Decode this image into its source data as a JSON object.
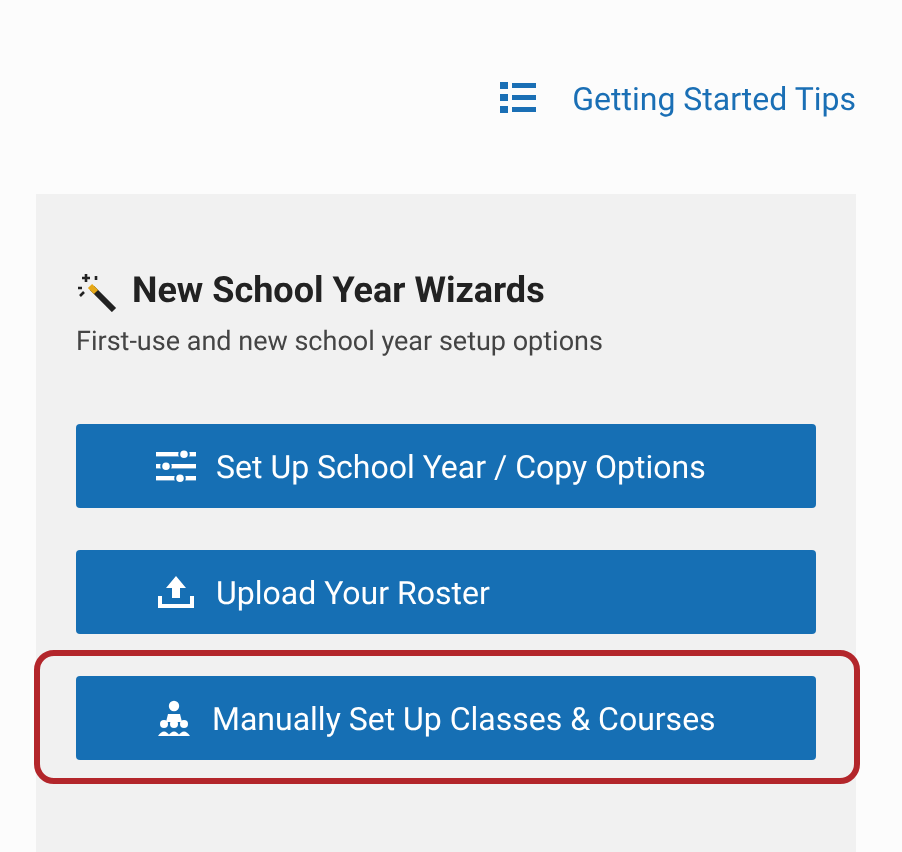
{
  "header_link": {
    "label": "Getting Started Tips"
  },
  "panel": {
    "title": "New School Year Wizards",
    "subtitle": "First-use and new school year setup options",
    "buttons": [
      {
        "label": "Set Up School Year / Copy Options",
        "kind": "sliders",
        "highlighted": false
      },
      {
        "label": "Upload Your Roster",
        "kind": "upload",
        "highlighted": false
      },
      {
        "label": "Manually Set Up Classes & Courses",
        "kind": "people",
        "highlighted": true
      }
    ]
  }
}
